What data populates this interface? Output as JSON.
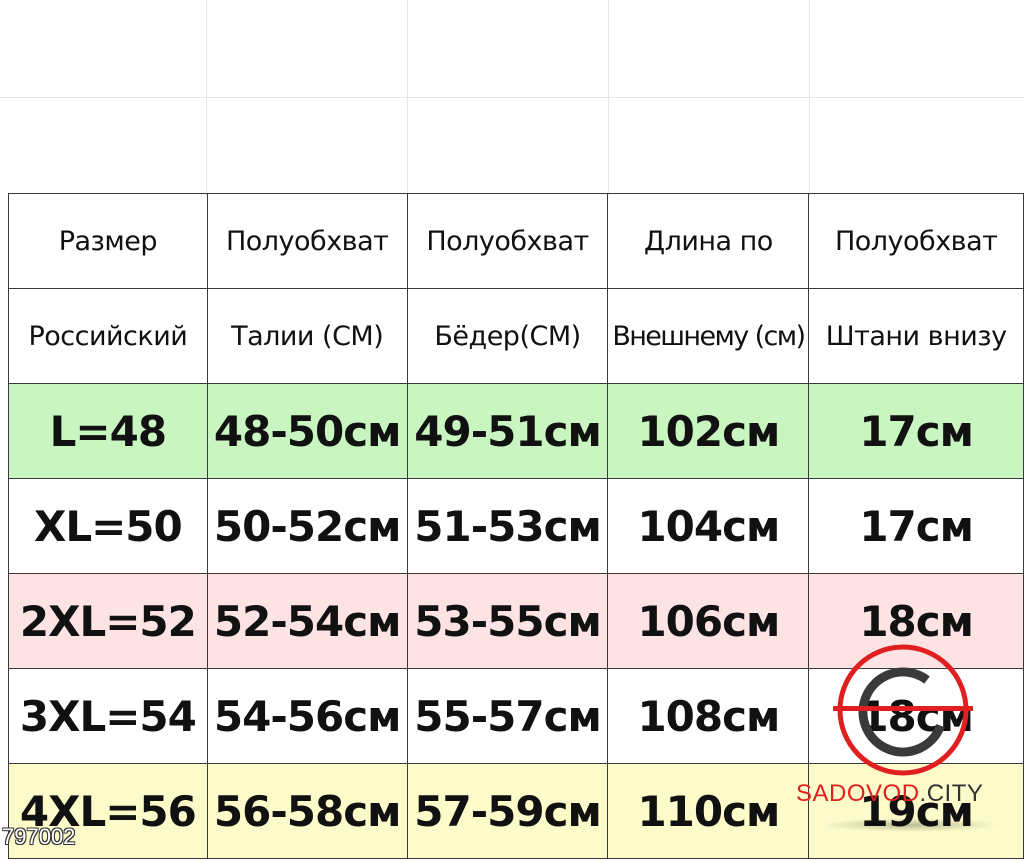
{
  "header_rows": [
    [
      "Размер",
      "Полуобхват",
      "Полуобхват",
      "Длина по",
      "Полуобхват"
    ],
    [
      "Российский",
      "Талии (СМ)",
      "Бёдер(СМ)",
      "Внешнему (см)",
      "Штани внизу"
    ]
  ],
  "rows": [
    {
      "bg": "#c8f5c0",
      "cells": [
        "L=48",
        "48-50см",
        "49-51см",
        "102см",
        "17см"
      ]
    },
    {
      "bg": "#ffffff",
      "cells": [
        "XL=50",
        "50-52см",
        "51-53см",
        "104см",
        "17см"
      ]
    },
    {
      "bg": "#fde3e3",
      "cells": [
        "2XL=52",
        "52-54см",
        "53-55см",
        "106см",
        "18см"
      ]
    },
    {
      "bg": "#ffffff",
      "cells": [
        "3XL=54",
        "54-56см",
        "55-57см",
        "108см",
        "18см"
      ]
    },
    {
      "bg": "#fdfbc9",
      "cells": [
        "4XL=56",
        "56-58см",
        "57-59см",
        "110см",
        "19см"
      ]
    }
  ],
  "watermark": {
    "brand_red": "SADOVOD",
    "brand_dark": ".CITY",
    "accent": "#e02020"
  },
  "code": "797002"
}
